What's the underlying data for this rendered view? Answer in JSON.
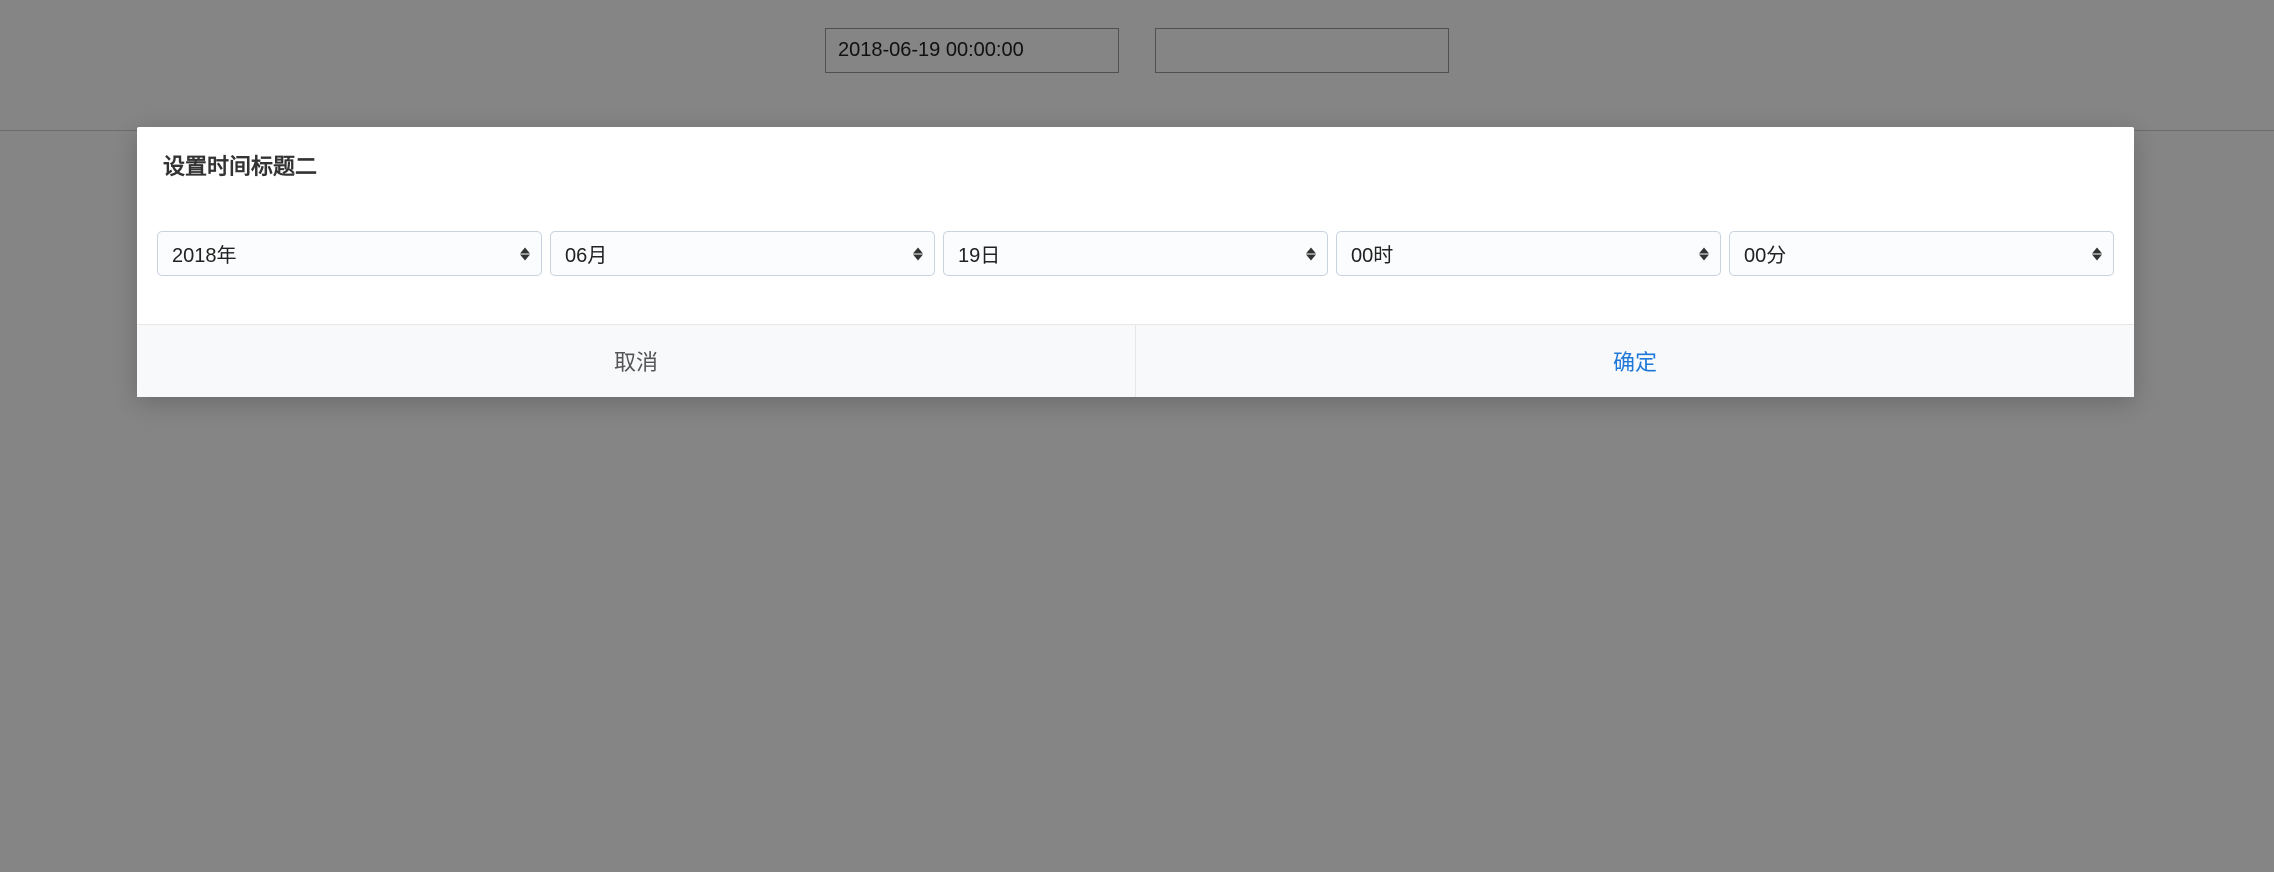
{
  "inputs": {
    "start_value": "2018-06-19 00:00:00",
    "end_value": ""
  },
  "dialog": {
    "title": "设置时间标题二",
    "selects": {
      "year": "2018年",
      "month": "06月",
      "day": "19日",
      "hour": "00时",
      "minute": "00分"
    },
    "buttons": {
      "cancel": "取消",
      "confirm": "确定"
    }
  }
}
